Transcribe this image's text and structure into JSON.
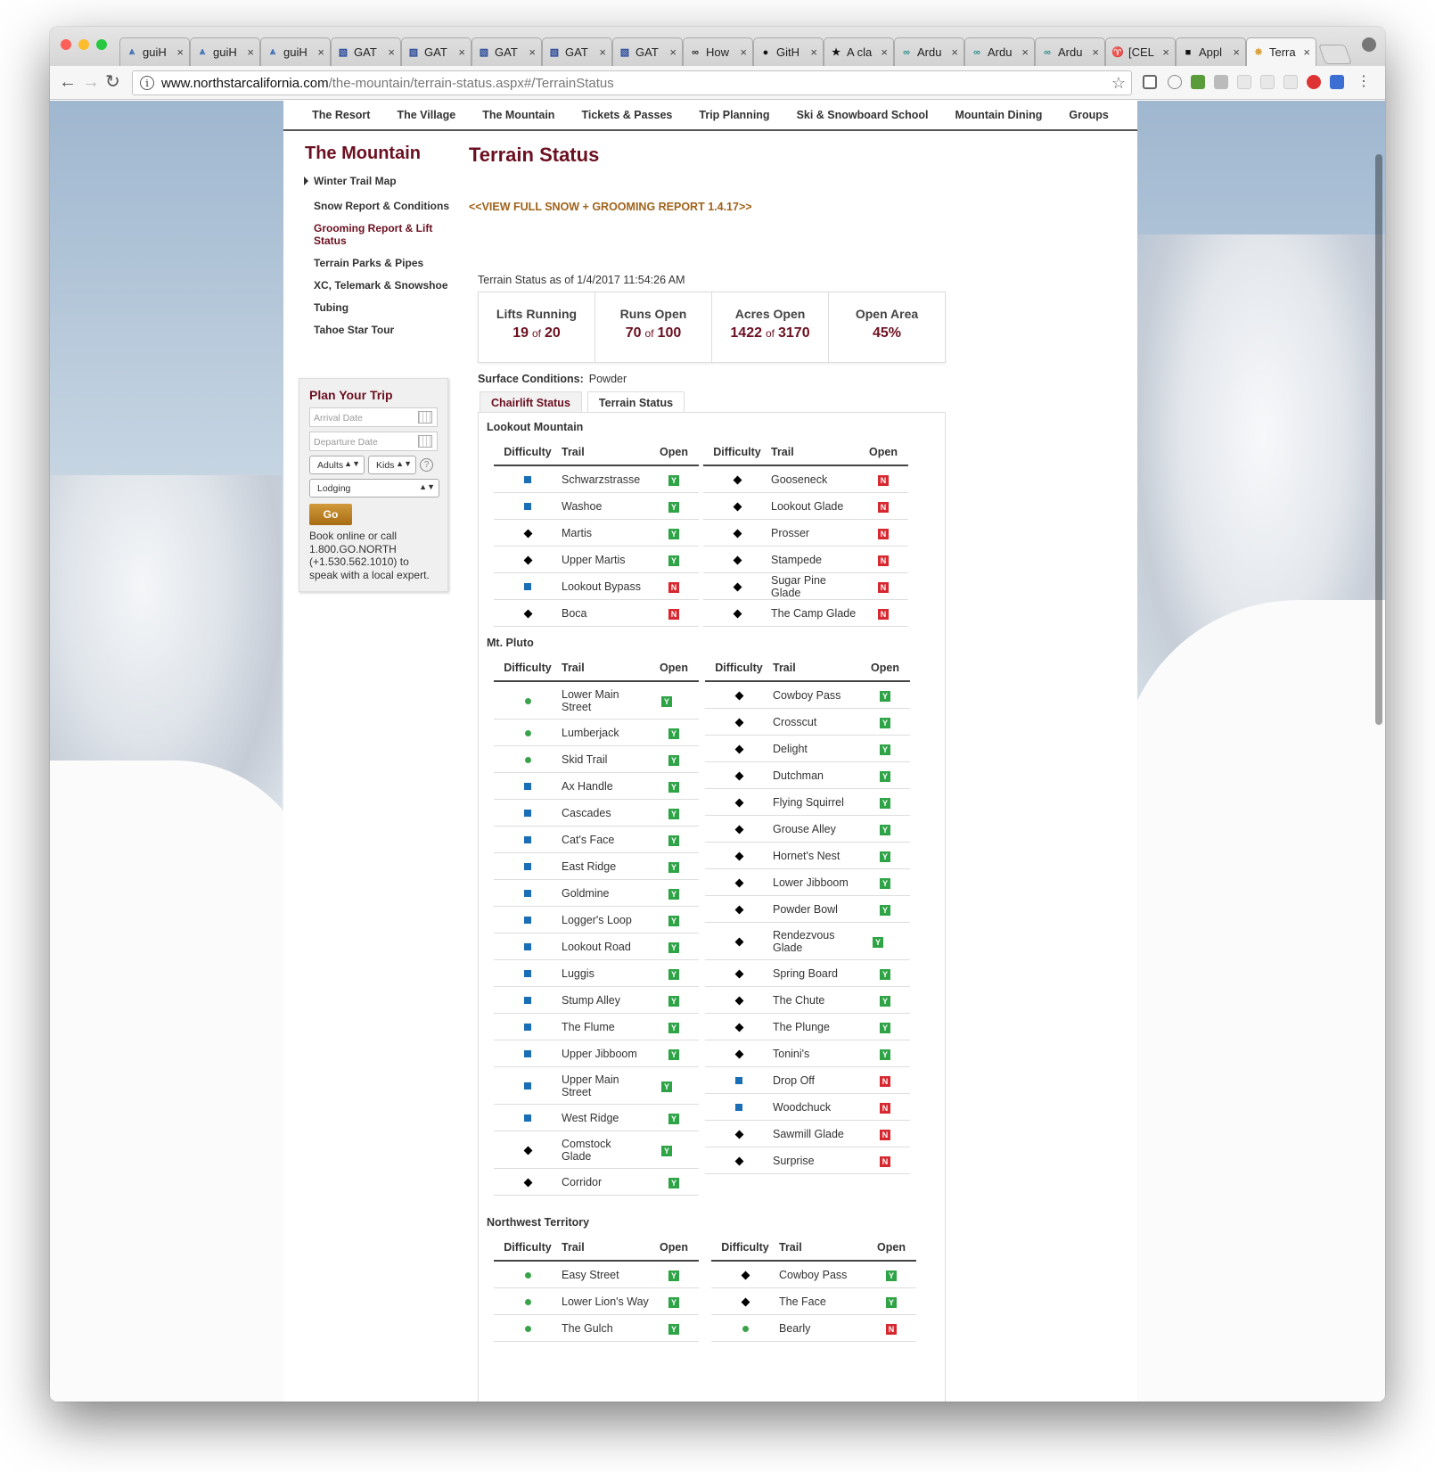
{
  "browser": {
    "tabs": [
      {
        "label": "guiH",
        "icon": "gui-icon"
      },
      {
        "label": "guiH",
        "icon": "gui-icon"
      },
      {
        "label": "guiH",
        "icon": "gui-icon"
      },
      {
        "label": "GAT",
        "icon": "gatt-icon"
      },
      {
        "label": "GAT",
        "icon": "gatt-icon"
      },
      {
        "label": "GAT",
        "icon": "gatt-icon"
      },
      {
        "label": "GAT",
        "icon": "gatt-icon"
      },
      {
        "label": "GAT",
        "icon": "gatt-icon"
      },
      {
        "label": "How",
        "icon": "instructables-icon"
      },
      {
        "label": "GitH",
        "icon": "github-icon"
      },
      {
        "label": "A cla",
        "icon": "star-box-icon"
      },
      {
        "label": "Ardu",
        "icon": "arduino-icon"
      },
      {
        "label": "Ardu",
        "icon": "arduino-icon"
      },
      {
        "label": "Ardu",
        "icon": "arduino-icon"
      },
      {
        "label": "[CEL",
        "icon": "cel-icon"
      },
      {
        "label": "Appl",
        "icon": "terminal-icon"
      },
      {
        "label": "Terra",
        "icon": "northstar-icon"
      }
    ],
    "close_glyph": "×",
    "url_host": "www.northstarcalifornia.com",
    "url_path": "/the-mountain/terrain-status.aspx#/TerrainStatus"
  },
  "topnav": [
    "The Resort",
    "The Village",
    "The Mountain",
    "Tickets & Passes",
    "Trip Planning",
    "Ski & Snowboard School",
    "Mountain Dining",
    "Groups"
  ],
  "sidebar": {
    "title": "The Mountain",
    "items": [
      "Winter Trail Map",
      "Snow Report & Conditions",
      "Grooming Report & Lift Status",
      "Terrain Parks & Pipes",
      "XC, Telemark & Snowshoe",
      "Tubing",
      "Tahoe Star Tour"
    ]
  },
  "plan_trip": {
    "title": "Plan Your Trip",
    "arrival_placeholder": "Arrival Date",
    "departure_placeholder": "Departure Date",
    "adults": "Adults",
    "kids": "Kids",
    "lodging": "Lodging",
    "go": "Go",
    "help": "?",
    "note": "Book online or call 1.800.GO.NORTH (+1.530.562.1010) to speak with a local expert."
  },
  "main": {
    "title": "Terrain Status",
    "full_report_link": "<<VIEW FULL SNOW + GROOMING REPORT 1.4.17>>",
    "as_of": "Terrain Status as of 1/4/2017 11:54:26 AM",
    "stats": [
      {
        "label": "Lifts Running",
        "value": "19",
        "of": "of",
        "total": "20"
      },
      {
        "label": "Runs Open",
        "value": "70",
        "of": "of",
        "total": "100"
      },
      {
        "label": "Acres Open",
        "value": "1422",
        "of": "of",
        "total": "3170"
      },
      {
        "label": "Open Area",
        "value": "45%",
        "of": "",
        "total": ""
      }
    ],
    "surface_label": "Surface Conditions:",
    "surface_value": "Powder",
    "status_tabs": [
      "Chairlift Status",
      "Terrain Status"
    ],
    "col_headers": {
      "difficulty": "Difficulty",
      "trail": "Trail",
      "open": "Open"
    }
  },
  "sections": [
    {
      "name": "Lookout Mountain",
      "left": [
        {
          "d": "blue",
          "t": "Schwarzstrasse",
          "o": "Y"
        },
        {
          "d": "blue",
          "t": "Washoe",
          "o": "Y"
        },
        {
          "d": "black",
          "t": "Martis",
          "o": "Y"
        },
        {
          "d": "black",
          "t": "Upper Martis",
          "o": "Y"
        },
        {
          "d": "blue",
          "t": "Lookout Bypass",
          "o": "N"
        },
        {
          "d": "black",
          "t": "Boca",
          "o": "N"
        }
      ],
      "right": [
        {
          "d": "black",
          "t": "Gooseneck",
          "o": "N"
        },
        {
          "d": "black",
          "t": "Lookout Glade",
          "o": "N"
        },
        {
          "d": "black",
          "t": "Prosser",
          "o": "N"
        },
        {
          "d": "black",
          "t": "Stampede",
          "o": "N"
        },
        {
          "d": "black",
          "t": "Sugar Pine Glade",
          "o": "N"
        },
        {
          "d": "black",
          "t": "The Camp Glade",
          "o": "N"
        }
      ]
    },
    {
      "name": "Mt. Pluto",
      "left": [
        {
          "d": "green",
          "t": "Lower Main Street",
          "o": "Y"
        },
        {
          "d": "green",
          "t": "Lumberjack",
          "o": "Y"
        },
        {
          "d": "green",
          "t": "Skid Trail",
          "o": "Y"
        },
        {
          "d": "blue",
          "t": "Ax Handle",
          "o": "Y"
        },
        {
          "d": "blue",
          "t": "Cascades",
          "o": "Y"
        },
        {
          "d": "blue",
          "t": "Cat's Face",
          "o": "Y"
        },
        {
          "d": "blue",
          "t": "East Ridge",
          "o": "Y"
        },
        {
          "d": "blue",
          "t": "Goldmine",
          "o": "Y"
        },
        {
          "d": "blue",
          "t": "Logger's Loop",
          "o": "Y"
        },
        {
          "d": "blue",
          "t": "Lookout Road",
          "o": "Y"
        },
        {
          "d": "blue",
          "t": "Luggis",
          "o": "Y"
        },
        {
          "d": "blue",
          "t": "Stump Alley",
          "o": "Y"
        },
        {
          "d": "blue",
          "t": "The Flume",
          "o": "Y"
        },
        {
          "d": "blue",
          "t": "Upper Jibboom",
          "o": "Y"
        },
        {
          "d": "blue",
          "t": "Upper Main Street",
          "o": "Y"
        },
        {
          "d": "blue",
          "t": "West Ridge",
          "o": "Y"
        },
        {
          "d": "black",
          "t": "Comstock Glade",
          "o": "Y"
        },
        {
          "d": "black",
          "t": "Corridor",
          "o": "Y"
        }
      ],
      "right": [
        {
          "d": "black",
          "t": "Cowboy Pass",
          "o": "Y"
        },
        {
          "d": "black",
          "t": "Crosscut",
          "o": "Y"
        },
        {
          "d": "black",
          "t": "Delight",
          "o": "Y"
        },
        {
          "d": "black",
          "t": "Dutchman",
          "o": "Y"
        },
        {
          "d": "black",
          "t": "Flying Squirrel",
          "o": "Y"
        },
        {
          "d": "black",
          "t": "Grouse Alley",
          "o": "Y"
        },
        {
          "d": "black",
          "t": "Hornet's Nest",
          "o": "Y"
        },
        {
          "d": "black",
          "t": "Lower Jibboom",
          "o": "Y"
        },
        {
          "d": "black",
          "t": "Powder Bowl",
          "o": "Y"
        },
        {
          "d": "black",
          "t": "Rendezvous Glade",
          "o": "Y"
        },
        {
          "d": "black",
          "t": "Spring Board",
          "o": "Y"
        },
        {
          "d": "black",
          "t": "The Chute",
          "o": "Y"
        },
        {
          "d": "black",
          "t": "The Plunge",
          "o": "Y"
        },
        {
          "d": "black",
          "t": "Tonini's",
          "o": "Y"
        },
        {
          "d": "blue",
          "t": "Drop Off",
          "o": "N"
        },
        {
          "d": "blue",
          "t": "Woodchuck",
          "o": "N"
        },
        {
          "d": "black",
          "t": "Sawmill Glade",
          "o": "N"
        },
        {
          "d": "black",
          "t": "Surprise",
          "o": "N"
        }
      ]
    },
    {
      "name": "Northwest Territory",
      "left": [
        {
          "d": "green",
          "t": "Easy Street",
          "o": "Y"
        },
        {
          "d": "green",
          "t": "Lower Lion's Way",
          "o": "Y"
        },
        {
          "d": "green",
          "t": "The Gulch",
          "o": "Y"
        }
      ],
      "right": [
        {
          "d": "black",
          "t": "Cowboy Pass",
          "o": "Y"
        },
        {
          "d": "black",
          "t": "The Face",
          "o": "Y"
        },
        {
          "d": "green",
          "t": "Bearly",
          "o": "N"
        }
      ]
    }
  ],
  "colors": {
    "brand": "#6b1020",
    "link": "#a0621a",
    "open_yes": "#2fa447",
    "open_no": "#d7282f",
    "green": "#3aa34a",
    "blue": "#1a6eb5"
  }
}
